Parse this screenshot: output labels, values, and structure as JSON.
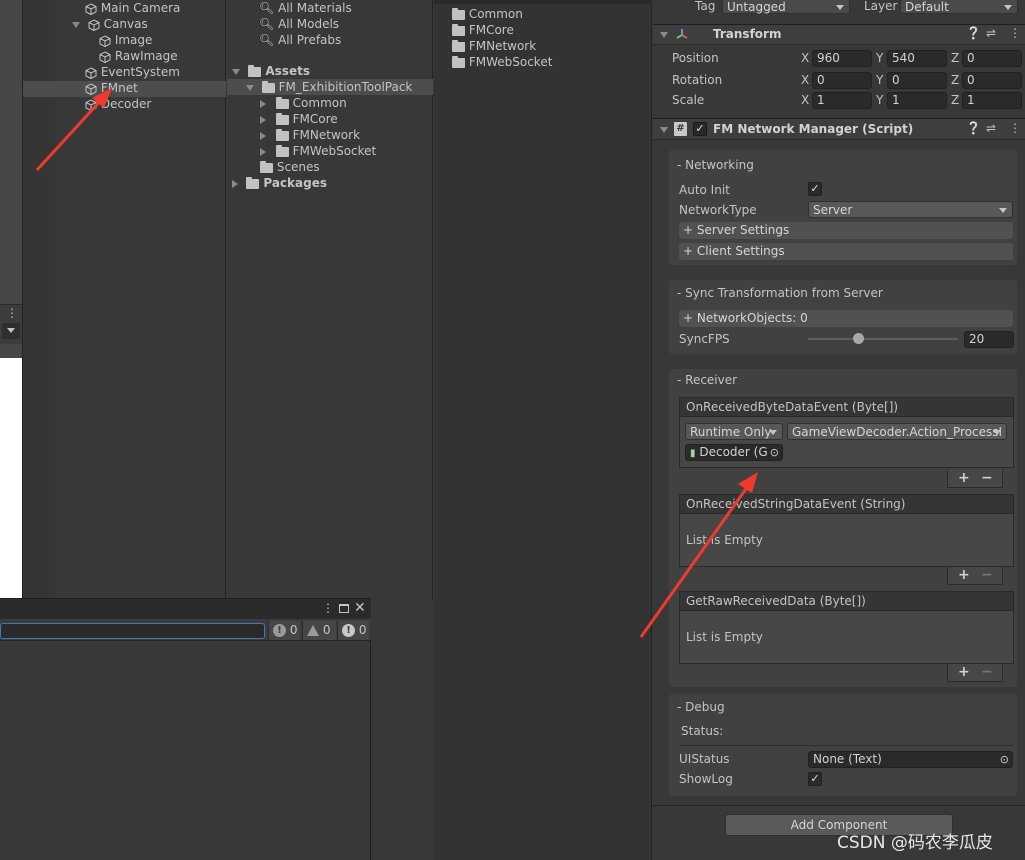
{
  "hierarchy": {
    "items": [
      {
        "label": "Main Camera"
      },
      {
        "label": "Canvas"
      },
      {
        "label": "Image"
      },
      {
        "label": "RawImage"
      },
      {
        "label": "EventSystem"
      },
      {
        "label": "FMnet"
      },
      {
        "label": "Decoder"
      }
    ]
  },
  "project": {
    "favorites": [
      "All Materials",
      "All Models",
      "All Prefabs"
    ],
    "assets_label": "Assets",
    "toolpack_label": "FM_ExhibitionToolPack",
    "toolpack_children": [
      "Common",
      "FMCore",
      "FMNetwork",
      "FMWebSocket"
    ],
    "scenes_label": "Scenes",
    "packages_label": "Packages"
  },
  "folder_view": {
    "items": [
      "Common",
      "FMCore",
      "FMNetwork",
      "FMWebSocket"
    ]
  },
  "console": {
    "counts": [
      "0",
      "0",
      "0"
    ]
  },
  "inspector": {
    "tag_label": "Tag",
    "tag_value": "Untagged",
    "layer_label": "Layer",
    "layer_value": "Default",
    "transform": {
      "title": "Transform",
      "rows": [
        {
          "label": "Position",
          "x": "960",
          "y": "540",
          "z": "0"
        },
        {
          "label": "Rotation",
          "x": "0",
          "y": "0",
          "z": "0"
        },
        {
          "label": "Scale",
          "x": "1",
          "y": "1",
          "z": "1"
        }
      ],
      "axis": [
        "X",
        "Y",
        "Z"
      ]
    },
    "script": {
      "title": "FM Network Manager (Script)",
      "networking": {
        "header": "- Networking",
        "auto_init_label": "Auto Init",
        "network_type_label": "NetworkType",
        "network_type_value": "Server",
        "server_settings": "+ Server Settings",
        "client_settings": "+ Client Settings"
      },
      "sync": {
        "header": "- Sync Transformation from Server",
        "network_objects": "+ NetworkObjects: 0",
        "sync_fps_label": "SyncFPS",
        "sync_fps_value": "20",
        "sync_fps_fraction": 0.3
      },
      "receiver": {
        "header": "- Receiver",
        "byte_event": "OnReceivedByteDataEvent (Byte[])",
        "runtime_only": "Runtime Only",
        "function": "GameViewDecoder.Action_ProcessI",
        "target_object": "Decoder (G",
        "string_event": "OnReceivedStringDataEvent (String)",
        "raw_event": "GetRawReceivedData (Byte[])",
        "list_empty": "List is Empty",
        "plus": "+",
        "minus": "−"
      },
      "debug": {
        "header": "- Debug",
        "status_label": "Status:",
        "ui_status_label": "UIStatus",
        "ui_status_value": "None (Text)",
        "show_log_label": "ShowLog"
      }
    },
    "add_component": "Add Component"
  },
  "watermark": "CSDN @码农李瓜皮",
  "colors": {
    "arrow": "#f03a2e",
    "selection": "#4d4d4d"
  }
}
